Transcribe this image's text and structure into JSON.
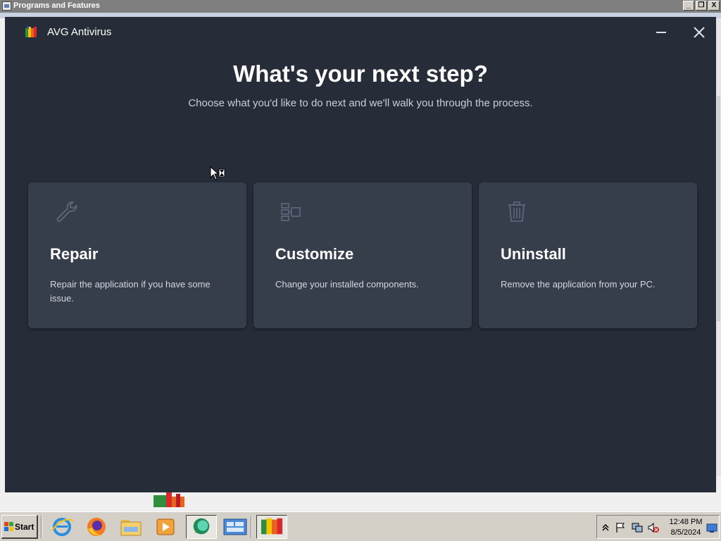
{
  "background_window": {
    "title": "Programs and Features",
    "controls": [
      "_",
      "❐",
      "X"
    ]
  },
  "avg": {
    "app_title": "AVG Antivirus",
    "heading": "What's your next step?",
    "subheading": "Choose what you'd like to do next and we'll walk you through the process.",
    "cards": [
      {
        "title": "Repair",
        "description": "Repair the application if you have some issue.",
        "icon": "wrench-icon"
      },
      {
        "title": "Customize",
        "description": "Change your installed components.",
        "icon": "components-icon"
      },
      {
        "title": "Uninstall",
        "description": "Remove the application from your PC.",
        "icon": "trash-icon"
      }
    ],
    "colors": {
      "background": "#262d38",
      "card": "#363e4c",
      "icon": "#5a6a7a",
      "heading": "#ffffff",
      "text": "#c9ced8"
    }
  },
  "taskbar": {
    "start_label": "Start",
    "pinned": [
      "internet-explorer-icon",
      "firefox-icon",
      "file-explorer-icon",
      "media-player-icon",
      "chat-app-icon",
      "control-panel-icon",
      "avg-icon"
    ],
    "tray_icons": [
      "show-hidden-icons-chevron",
      "action-center-flag-icon",
      "network-icon",
      "volume-muted-icon",
      "show-desktop-icon"
    ],
    "clock_time": "12:48 PM",
    "clock_date": "8/5/2024"
  }
}
